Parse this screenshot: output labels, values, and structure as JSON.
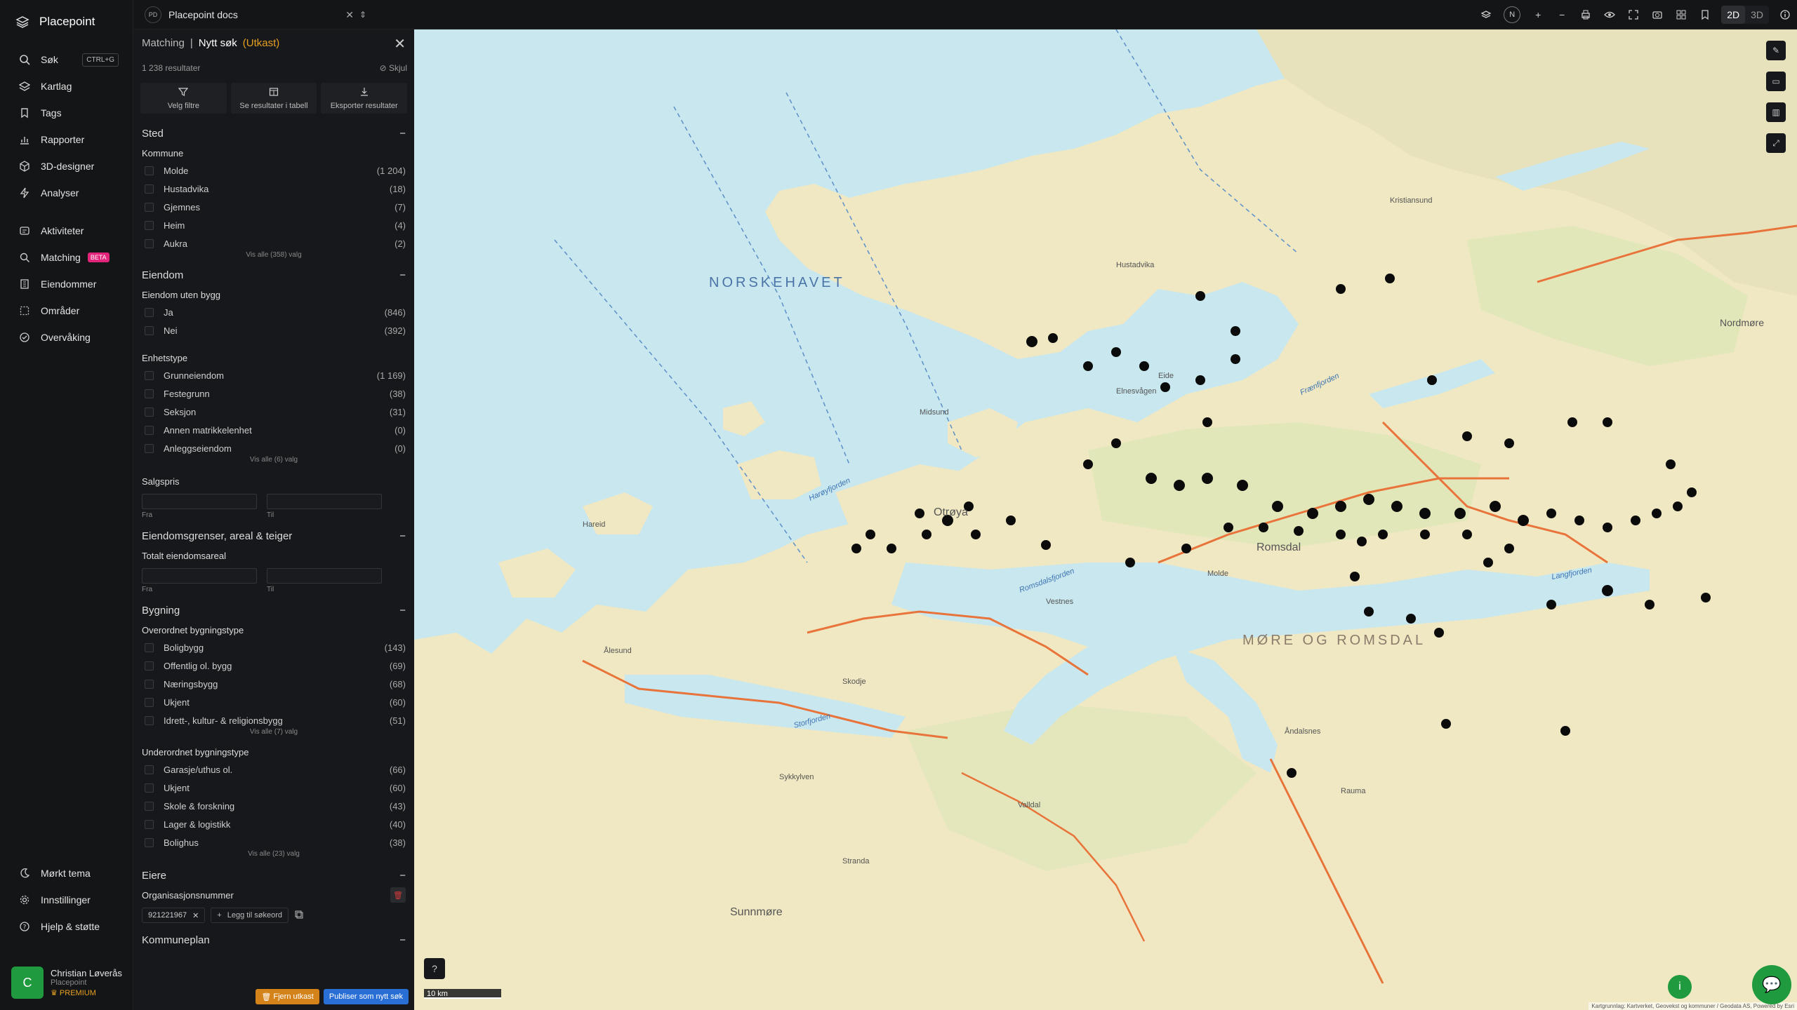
{
  "app": {
    "name": "Placepoint"
  },
  "nav": {
    "search_label": "Søk",
    "search_shortcut": "CTRL+G",
    "items_top": [
      {
        "label": "Kartlag"
      },
      {
        "label": "Tags"
      },
      {
        "label": "Rapporter"
      },
      {
        "label": "3D-designer"
      },
      {
        "label": "Analyser"
      }
    ],
    "items_mid": [
      {
        "label": "Aktiviteter"
      },
      {
        "label": "Matching",
        "badge": "BETA"
      },
      {
        "label": "Eiendommer"
      },
      {
        "label": "Områder"
      },
      {
        "label": "Overvåking"
      }
    ],
    "items_bottom": [
      {
        "label": "Mørkt tema"
      },
      {
        "label": "Innstillinger"
      },
      {
        "label": "Hjelp & støtte"
      }
    ],
    "user": {
      "initial": "C",
      "name": "Christian Løverås",
      "org": "Placepoint",
      "tier": "PREMIUM"
    }
  },
  "topbar": {
    "doc_badge": "PD",
    "doc_name": "Placepoint docs",
    "north": "N",
    "view_2d": "2D",
    "view_3d": "3D"
  },
  "panel": {
    "crumb": "Matching",
    "sep": "|",
    "title": "Nytt søk",
    "draft": "(Utkast)",
    "result_count": "1 238 resultater",
    "hide_label": "Skjul",
    "actions": [
      "Velg filtre",
      "Se resultater i tabell",
      "Eksporter resultater"
    ],
    "sted": {
      "title": "Sted",
      "kommune_title": "Kommune",
      "kommune": [
        {
          "label": "Molde",
          "count": "(1 204)"
        },
        {
          "label": "Hustadvika",
          "count": "(18)"
        },
        {
          "label": "Gjemnes",
          "count": "(7)"
        },
        {
          "label": "Heim",
          "count": "(4)"
        },
        {
          "label": "Aukra",
          "count": "(2)"
        }
      ],
      "kommune_show_all": "Vis alle (358) valg"
    },
    "eiendom": {
      "title": "Eiendom",
      "uten_bygg_title": "Eiendom uten bygg",
      "uten_bygg": [
        {
          "label": "Ja",
          "count": "(846)"
        },
        {
          "label": "Nei",
          "count": "(392)"
        }
      ],
      "enhetstype_title": "Enhetstype",
      "enhetstype": [
        {
          "label": "Grunneiendom",
          "count": "(1 169)"
        },
        {
          "label": "Festegrunn",
          "count": "(38)"
        },
        {
          "label": "Seksjon",
          "count": "(31)"
        },
        {
          "label": "Annen matrikkelenhet",
          "count": "(0)"
        },
        {
          "label": "Anleggseiendom",
          "count": "(0)"
        }
      ],
      "enhetstype_show_all": "Vis alle (6) valg",
      "salgspris_title": "Salgspris",
      "from": "Fra",
      "to": "Til"
    },
    "grenser": {
      "title": "Eiendomsgrenser, areal & teiger",
      "totalt_title": "Totalt eiendomsareal",
      "from": "Fra",
      "to": "Til"
    },
    "bygning": {
      "title": "Bygning",
      "overordnet_title": "Overordnet bygningstype",
      "overordnet": [
        {
          "label": "Boligbygg",
          "count": "(143)"
        },
        {
          "label": "Offentlig ol. bygg",
          "count": "(69)"
        },
        {
          "label": "Næringsbygg",
          "count": "(68)"
        },
        {
          "label": "Ukjent",
          "count": "(60)"
        },
        {
          "label": "Idrett-, kultur- & religionsbygg",
          "count": "(51)"
        }
      ],
      "overordnet_show_all": "Vis alle (7) valg",
      "underordnet_title": "Underordnet bygningstype",
      "underordnet": [
        {
          "label": "Garasje/uthus ol.",
          "count": "(66)"
        },
        {
          "label": "Ukjent",
          "count": "(60)"
        },
        {
          "label": "Skole & forskning",
          "count": "(43)"
        },
        {
          "label": "Lager & logistikk",
          "count": "(40)"
        },
        {
          "label": "Bolighus",
          "count": "(38)"
        }
      ],
      "underordnet_show_all": "Vis alle (23) valg"
    },
    "eiere": {
      "title": "Eiere",
      "org_title": "Organisasjonsnummer",
      "org_value": "921221967",
      "add_label": "Legg til søkeord"
    },
    "kommuneplan": {
      "title": "Kommuneplan"
    },
    "btn_remove": "Fjern utkast",
    "btn_publish": "Publiser som nytt søk"
  },
  "map": {
    "sea_label": "NORSKEHAVET",
    "region_label": "MØRE OG ROMSDAL",
    "places": [
      "Kristiansund",
      "Hustadvika",
      "Otrøya",
      "Romsdal",
      "Ålesund",
      "Vestnes",
      "Åndalsnes",
      "Sunnmøre",
      "Nordmøre",
      "Midsund",
      "Eide",
      "Elnesvågen",
      "Skodje",
      "Sykkylven",
      "Stranda",
      "Molde",
      "Rauma",
      "Hareid",
      "Valldal"
    ],
    "water_labels": [
      "Romsdalsfjorden",
      "Storfjorden",
      "Langfjorden",
      "Harøyfjorden",
      "Frænfjorden"
    ],
    "scale_label": "10 km",
    "attribution": "Kartgrunnlag: Kartverket, Geovekst og kommuner / Geodata AS, Powered by Esri",
    "accent_colors": {
      "sea": "#c9e7ef",
      "land": "#efe8c2",
      "forest": "#d8e6b3",
      "road": "#e8743b",
      "marker": "#0b0b0b"
    }
  }
}
